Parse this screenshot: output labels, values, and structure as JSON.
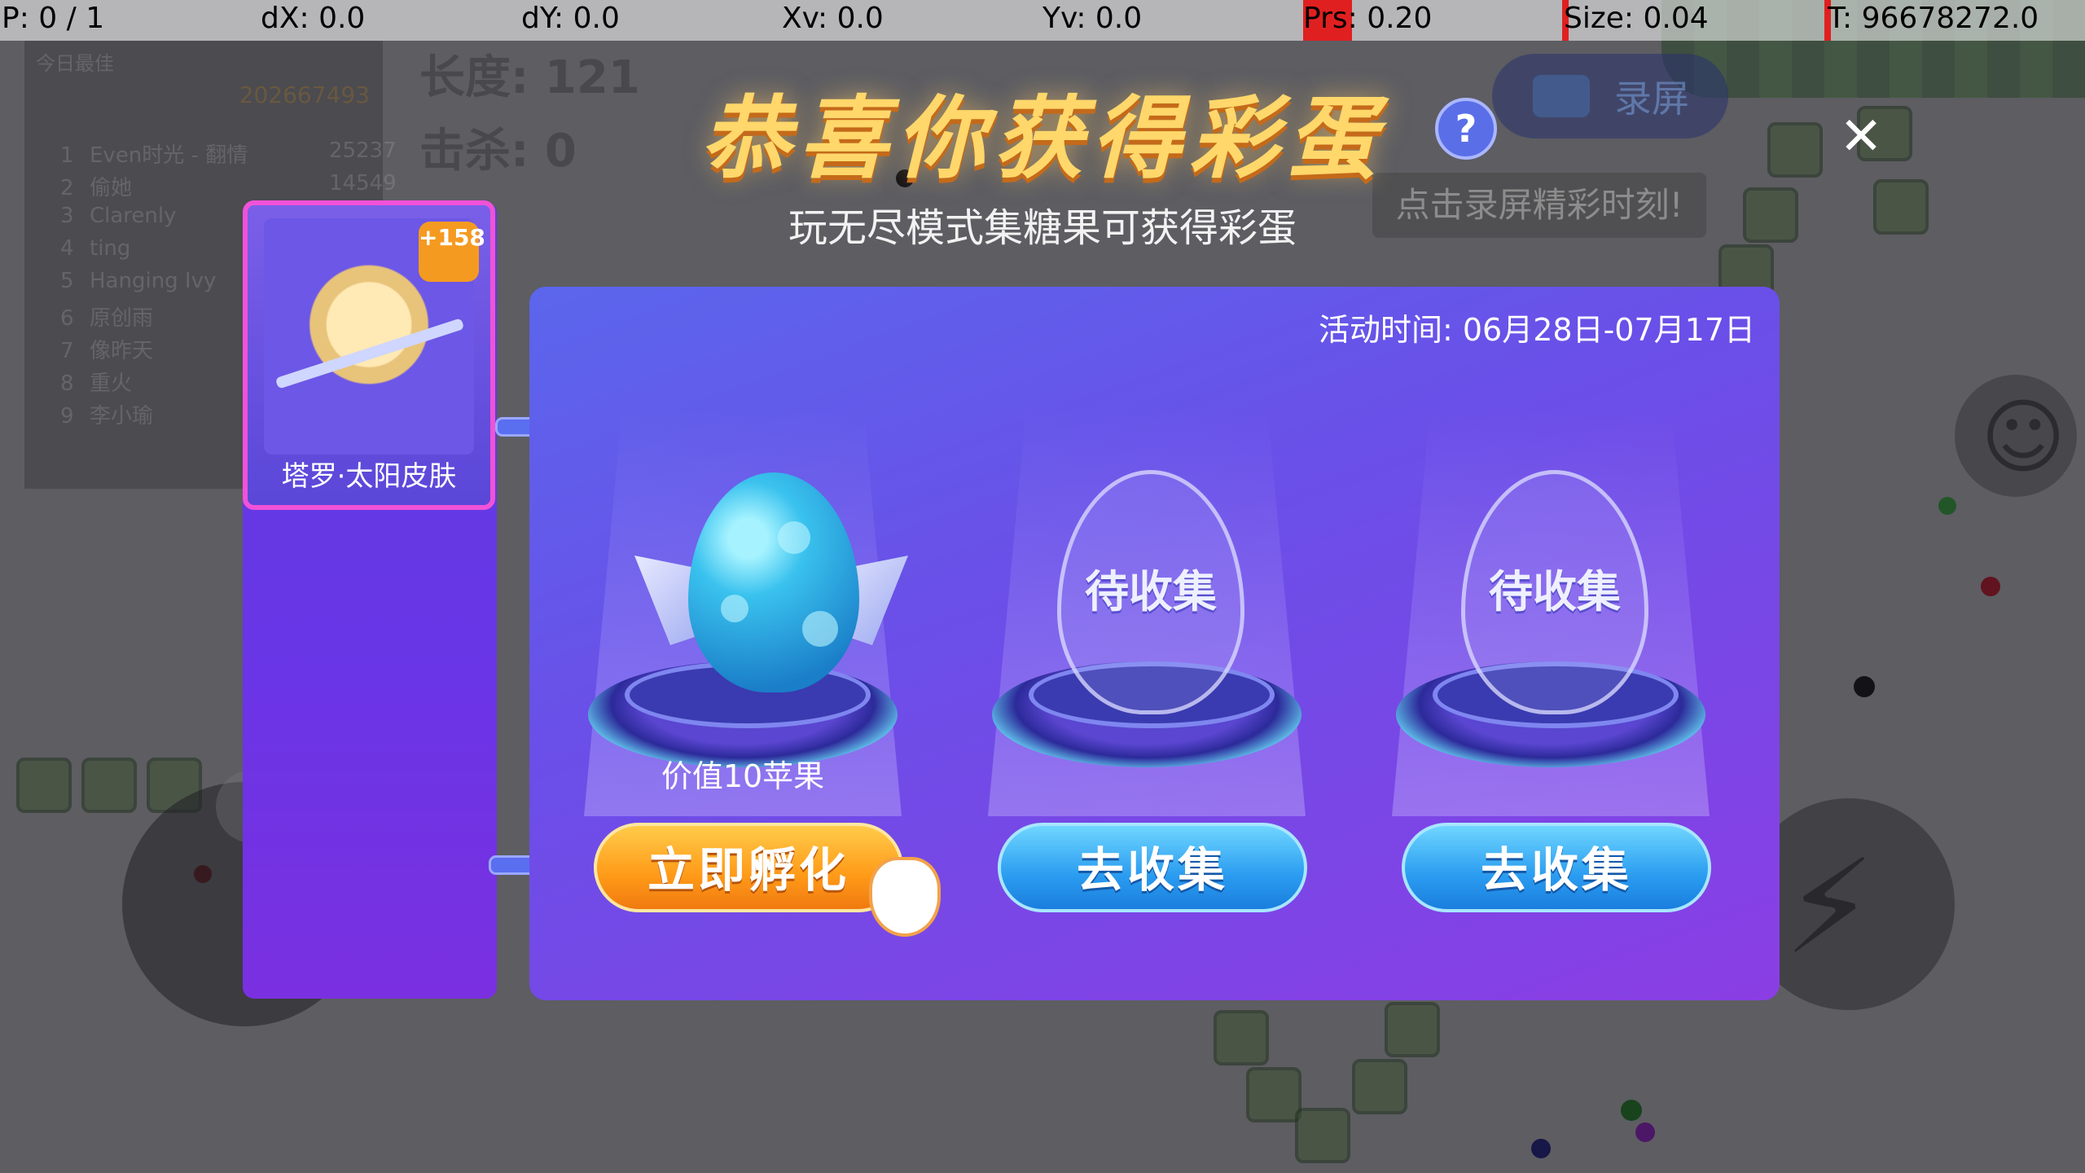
{
  "debug": {
    "p": "P: 0 / 1",
    "dx": "dX: 0.0",
    "dy": "dY: 0.0",
    "xv": "Xv: 0.0",
    "yv": "Yv: 0.0",
    "prs": "Prs: 0.20",
    "size": "Size: 0.04",
    "t": "T: 96678272.0"
  },
  "leaderboard": {
    "title": "今日最佳",
    "top_score": "202667493",
    "rows": [
      {
        "rank": "1",
        "name": "Even时光 - 翻情",
        "score": "25237"
      },
      {
        "rank": "2",
        "name": "偷她",
        "score": "14549"
      },
      {
        "rank": "3",
        "name": "Clarenly",
        "score": ""
      },
      {
        "rank": "4",
        "name": "ting",
        "score": ""
      },
      {
        "rank": "5",
        "name": "Hanging Ivy",
        "score": ""
      },
      {
        "rank": "6",
        "name": "原创雨",
        "score": ""
      },
      {
        "rank": "7",
        "name": "像昨天",
        "score": ""
      },
      {
        "rank": "8",
        "name": "重火",
        "score": ""
      },
      {
        "rank": "9",
        "name": "李小瑜",
        "score": ""
      }
    ]
  },
  "hud": {
    "length": "长度: 121",
    "kills": "击杀: 0"
  },
  "record": {
    "label": "录屏",
    "tip": "点击录屏精彩时刻!"
  },
  "modal": {
    "title": "恭喜你获得彩蛋",
    "help": "?",
    "close": "✕",
    "subtitle": "玩无尽模式集糖果可获得彩蛋",
    "activity_time": "活动时间: 06月28日-07月17日",
    "reward": {
      "label": "塔罗·太阳皮肤",
      "badge": "+158"
    },
    "slots": [
      {
        "state": "collected",
        "value_label": "价值10苹果",
        "button": "立即孵化"
      },
      {
        "state": "pending",
        "ghost_label": "待收集",
        "button": "去收集"
      },
      {
        "state": "pending",
        "ghost_label": "待收集",
        "button": "去收集"
      }
    ]
  },
  "colors": {
    "panel": "#6a4fe8",
    "orange_button": "#ff9a18",
    "blue_button": "#2a9cf0",
    "card_border": "#f052d8",
    "title_gold": "#ffd76a"
  }
}
